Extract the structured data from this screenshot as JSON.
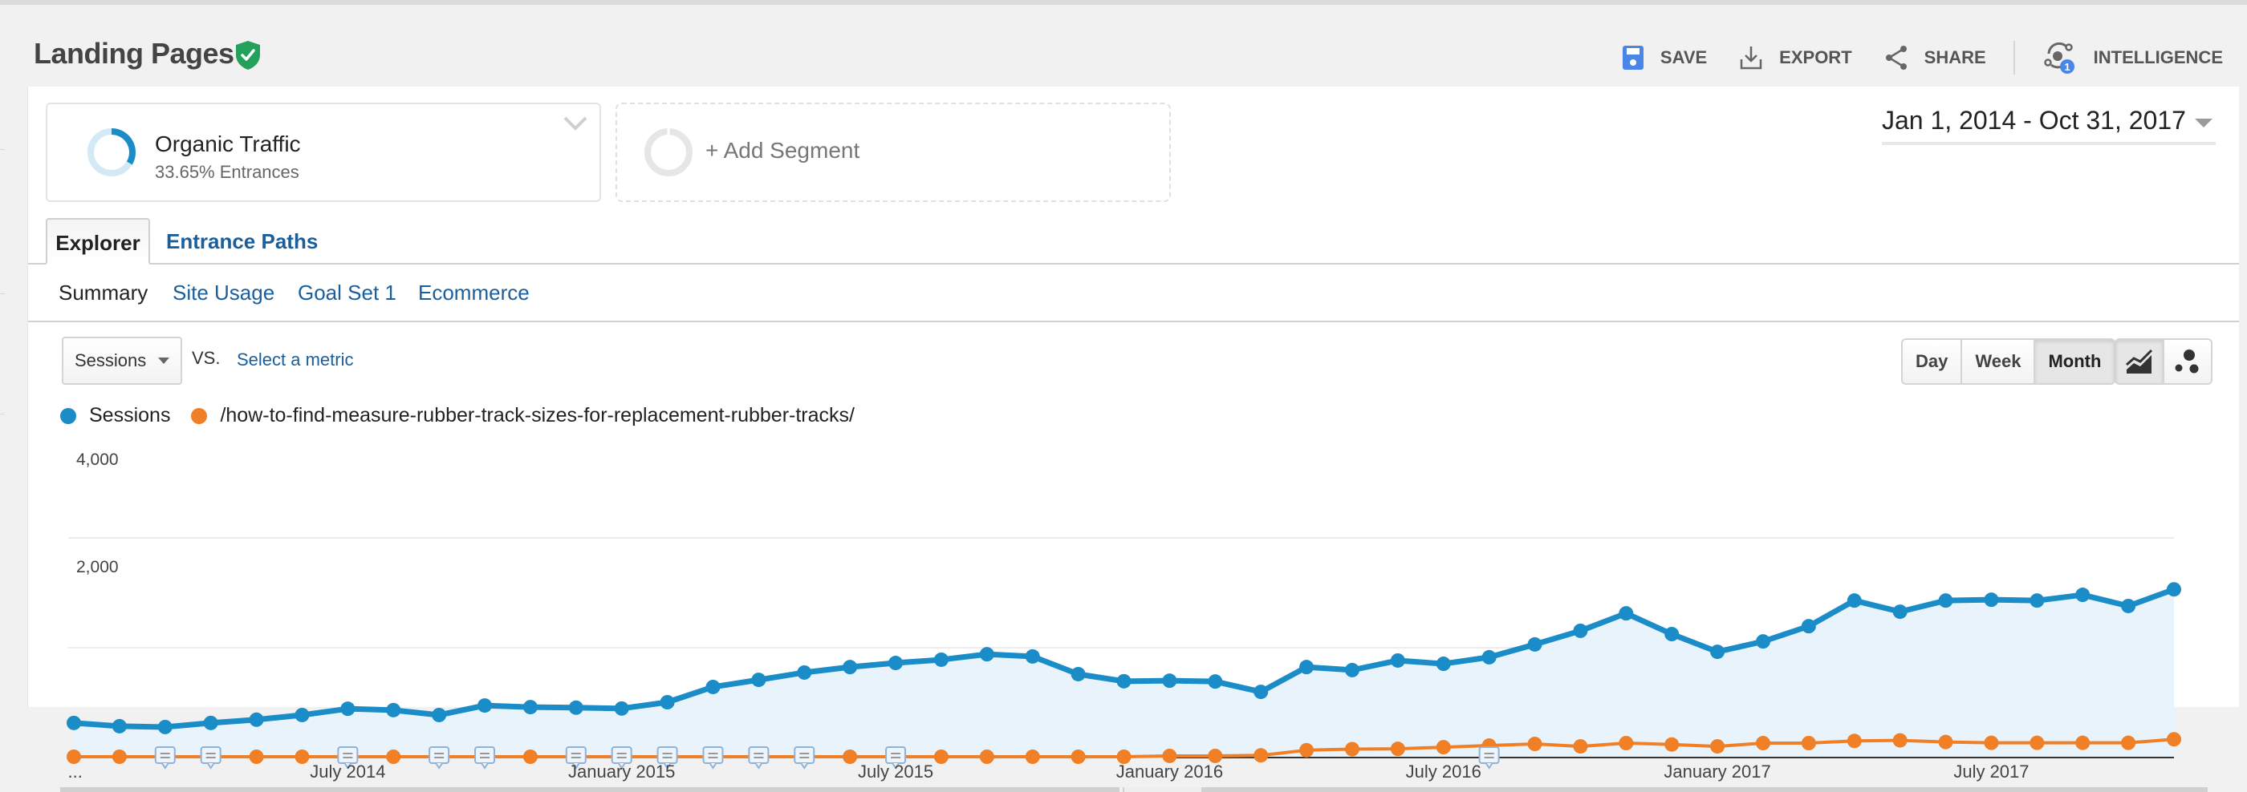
{
  "header": {
    "title": "Landing Pages",
    "verified_icon": "shield-check-icon",
    "actions": [
      {
        "label": "SAVE",
        "icon": "save-icon"
      },
      {
        "label": "EXPORT",
        "icon": "export-icon"
      },
      {
        "label": "SHARE",
        "icon": "share-icon"
      },
      {
        "label": "INTELLIGENCE",
        "icon": "intelligence-icon",
        "badge": "1"
      }
    ]
  },
  "segments": {
    "active": {
      "name": "Organic Traffic",
      "detail": "33.65% Entrances",
      "share_pct": 33.65
    },
    "add_label": "+ Add Segment"
  },
  "date_range": "Jan 1, 2014 - Oct 31, 2017",
  "tabs": [
    {
      "label": "Explorer",
      "active": true
    },
    {
      "label": "Entrance Paths",
      "active": false
    }
  ],
  "subtabs": [
    {
      "label": "Summary",
      "active": true
    },
    {
      "label": "Site Usage",
      "active": false
    },
    {
      "label": "Goal Set 1",
      "active": false
    },
    {
      "label": "Ecommerce",
      "active": false
    }
  ],
  "metric": {
    "selected": "Sessions",
    "vs_label": "VS.",
    "compare_link": "Select a metric"
  },
  "period_buttons": [
    {
      "label": "Day",
      "active": false
    },
    {
      "label": "Week",
      "active": false
    },
    {
      "label": "Month",
      "active": true
    }
  ],
  "chart_type_buttons": [
    {
      "icon": "line-chart-icon",
      "active": true
    },
    {
      "icon": "motion-chart-icon",
      "active": false
    }
  ],
  "colors": {
    "sessions": "#1a8cc8",
    "page": "#f07f25",
    "area": "#e8f3fb",
    "link": "#1a5e9c",
    "save_icon": "#4a86e8",
    "shield": "#23a05a",
    "badge": "#4a86e8"
  },
  "chart_data": {
    "type": "line",
    "title": "",
    "xlabel": "",
    "ylabel": "Sessions",
    "ylim": [
      0,
      4000
    ],
    "yticks": [
      "4,000",
      "2,000"
    ],
    "ytick_values": [
      4000,
      2000
    ],
    "grid": true,
    "legend_position": "top-left",
    "x_tick_labels": [
      {
        "label": "...",
        "index": 0
      },
      {
        "label": "July 2014",
        "index": 6
      },
      {
        "label": "January 2015",
        "index": 12
      },
      {
        "label": "July 2015",
        "index": 18
      },
      {
        "label": "January 2016",
        "index": 24
      },
      {
        "label": "July 2016",
        "index": 30
      },
      {
        "label": "January 2017",
        "index": 36
      },
      {
        "label": "July 2017",
        "index": 42
      }
    ],
    "x": [
      "2014-01",
      "2014-02",
      "2014-03",
      "2014-04",
      "2014-05",
      "2014-06",
      "2014-07",
      "2014-08",
      "2014-09",
      "2014-10",
      "2014-11",
      "2014-12",
      "2015-01",
      "2015-02",
      "2015-03",
      "2015-04",
      "2015-05",
      "2015-06",
      "2015-07",
      "2015-08",
      "2015-09",
      "2015-10",
      "2015-11",
      "2015-12",
      "2016-01",
      "2016-02",
      "2016-03",
      "2016-04",
      "2016-05",
      "2016-06",
      "2016-07",
      "2016-08",
      "2016-09",
      "2016-10",
      "2016-11",
      "2016-12",
      "2017-01",
      "2017-02",
      "2017-03",
      "2017-04",
      "2017-05",
      "2017-06",
      "2017-07",
      "2017-08",
      "2017-09",
      "2017-10"
    ],
    "series": [
      {
        "name": "Sessions",
        "color": "#1a8cc8",
        "area": true,
        "values": [
          620,
          560,
          545,
          620,
          680,
          765,
          880,
          855,
          765,
          940,
          910,
          900,
          885,
          1000,
          1280,
          1410,
          1545,
          1645,
          1720,
          1780,
          1880,
          1840,
          1515,
          1385,
          1395,
          1380,
          1190,
          1645,
          1590,
          1765,
          1705,
          1825,
          2060,
          2310,
          2630,
          2250,
          1925,
          2115,
          2395,
          2865,
          2660,
          2865,
          2880,
          2865,
          2970,
          2765,
          3070
        ]
      },
      {
        "name": "/how-to-find-measure-rubber-track-sizes-for-replacement-rubber-tracks/",
        "color": "#f07f25",
        "area": false,
        "values": [
          0,
          0,
          0,
          0,
          0,
          0,
          0,
          0,
          0,
          0,
          0,
          0,
          0,
          0,
          0,
          0,
          0,
          0,
          0,
          0,
          0,
          0,
          0,
          0,
          15,
          15,
          25,
          120,
          140,
          145,
          175,
          205,
          235,
          190,
          250,
          225,
          190,
          250,
          250,
          290,
          300,
          270,
          255,
          255,
          255,
          255,
          320
        ]
      }
    ],
    "annotation_markers_at_index": [
      2,
      3,
      6,
      8,
      9,
      11,
      12,
      13,
      14,
      15,
      16,
      18,
      31
    ]
  }
}
